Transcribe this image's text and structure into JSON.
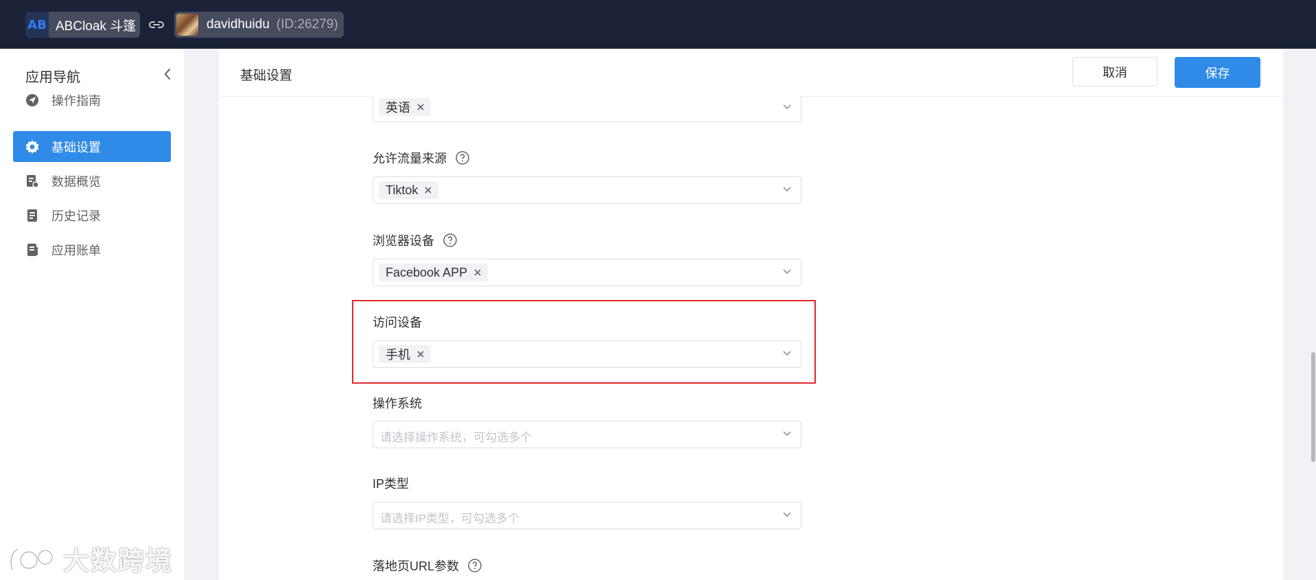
{
  "topbar": {
    "app_logo": "AB",
    "app_name": "ABCloak 斗篷",
    "user_name": "davidhuidu",
    "user_id": "(ID:26279)"
  },
  "sidebar": {
    "title": "应用导航",
    "items": [
      {
        "label": "操作指南",
        "icon": "navigation-icon",
        "active": false
      },
      {
        "label": "基础设置",
        "icon": "gear-icon",
        "active": true
      },
      {
        "label": "数据概览",
        "icon": "report-icon",
        "active": false
      },
      {
        "label": "历史记录",
        "icon": "document-icon",
        "active": false
      },
      {
        "label": "应用账单",
        "icon": "bill-icon",
        "active": false
      }
    ]
  },
  "main": {
    "title": "基础设置",
    "cancel_label": "取消",
    "save_label": "保存",
    "fields": {
      "language": {
        "tag": "英语"
      },
      "traffic_source": {
        "label": "允许流量来源",
        "tag": "Tiktok"
      },
      "browser_device": {
        "label": "浏览器设备",
        "tag": "Facebook APP"
      },
      "visit_device": {
        "label": "访问设备",
        "tag": "手机"
      },
      "os": {
        "label": "操作系统",
        "placeholder": "请选择操作系统，可勾选多个"
      },
      "ip_type": {
        "label": "IP类型",
        "placeholder": "请选择IP类型，可勾选多个"
      },
      "landing_url": {
        "label": "落地页URL参数"
      }
    }
  },
  "watermark": {
    "text": "大数跨境"
  },
  "colors": {
    "accent": "#2f8ae8",
    "topbar": "#1b2238",
    "highlight": "#e0262a"
  }
}
